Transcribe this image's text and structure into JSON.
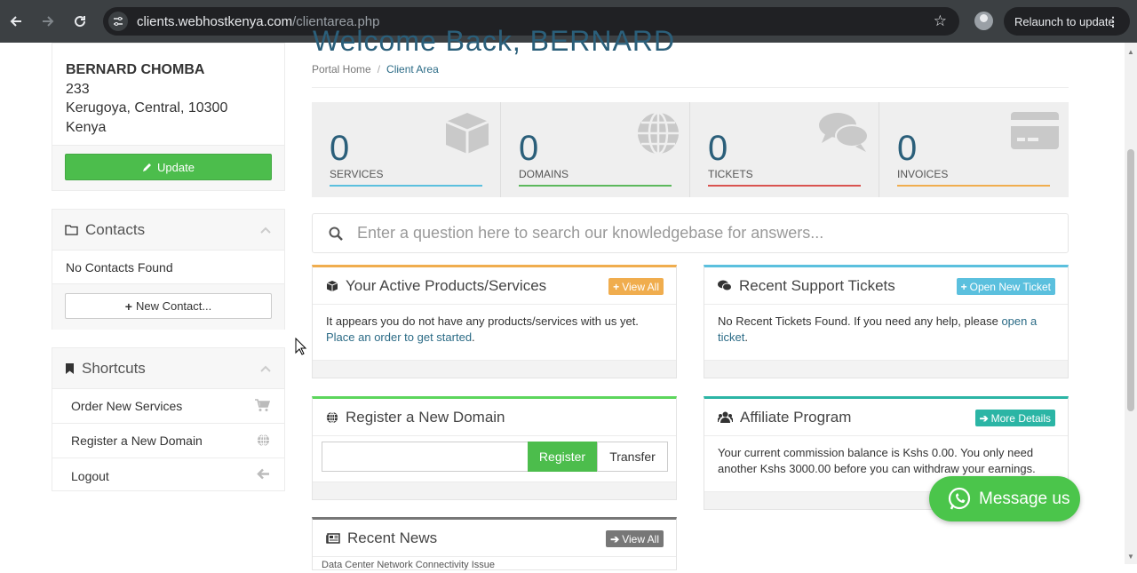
{
  "browser": {
    "url_host": "clients.webhostkenya.com",
    "url_path": "/clientarea.php",
    "relaunch_label": "Relaunch to update"
  },
  "page": {
    "heading_partial": "Welcome Back, BERNARD"
  },
  "client": {
    "name": "BERNARD CHOMBA",
    "line1": "233",
    "line2": "Kerugoya, Central, 10300",
    "line3": "Kenya",
    "update_label": "Update"
  },
  "contacts": {
    "title": "Contacts",
    "empty": "No Contacts Found",
    "new_label": "New Contact..."
  },
  "shortcuts": {
    "title": "Shortcuts",
    "items": [
      {
        "label": "Order New Services",
        "icon": "cart-icon"
      },
      {
        "label": "Register a New Domain",
        "icon": "globe-icon"
      },
      {
        "label": "Logout",
        "icon": "arrow-left-icon"
      }
    ]
  },
  "breadcrumb": {
    "home": "Portal Home",
    "current": "Client Area"
  },
  "stats": [
    {
      "count": "0",
      "label": "SERVICES",
      "color": "#5bc0de",
      "icon": "cube-icon"
    },
    {
      "count": "0",
      "label": "DOMAINS",
      "color": "#5cb85c",
      "icon": "globe-icon"
    },
    {
      "count": "0",
      "label": "TICKETS",
      "color": "#d9534f",
      "icon": "comments-icon"
    },
    {
      "count": "0",
      "label": "INVOICES",
      "color": "#f0ad4e",
      "icon": "credit-card-icon"
    }
  ],
  "search": {
    "placeholder": "Enter a question here to search our knowledgebase for answers..."
  },
  "products": {
    "title": "Your Active Products/Services",
    "tag": "View All",
    "tag_color": "#f0ad4e",
    "text": "It appears you do not have any products/services with us yet.",
    "link": "Place an order to get started",
    "tail": "."
  },
  "tickets": {
    "title": "Recent Support Tickets",
    "tag": "Open New Ticket",
    "tag_color": "#5bc0de",
    "text": "No Recent Tickets Found. If you need any help, please",
    "link": "open a ticket",
    "tail": "."
  },
  "domain": {
    "title": "Register a New Domain",
    "register": "Register",
    "transfer": "Transfer"
  },
  "affiliate": {
    "title": "Affiliate Program",
    "tag": "More Details",
    "tag_color": "#2bb5a5",
    "text": "Your current commission balance is Kshs 0.00. You only need another Kshs 3000.00 before you can withdraw your earnings."
  },
  "news": {
    "title": "Recent News",
    "tag": "View All",
    "tag_color": "#777777",
    "first_item": "Data Center Network Connectivity Issue"
  },
  "whatsapp": {
    "label": "Message us"
  }
}
